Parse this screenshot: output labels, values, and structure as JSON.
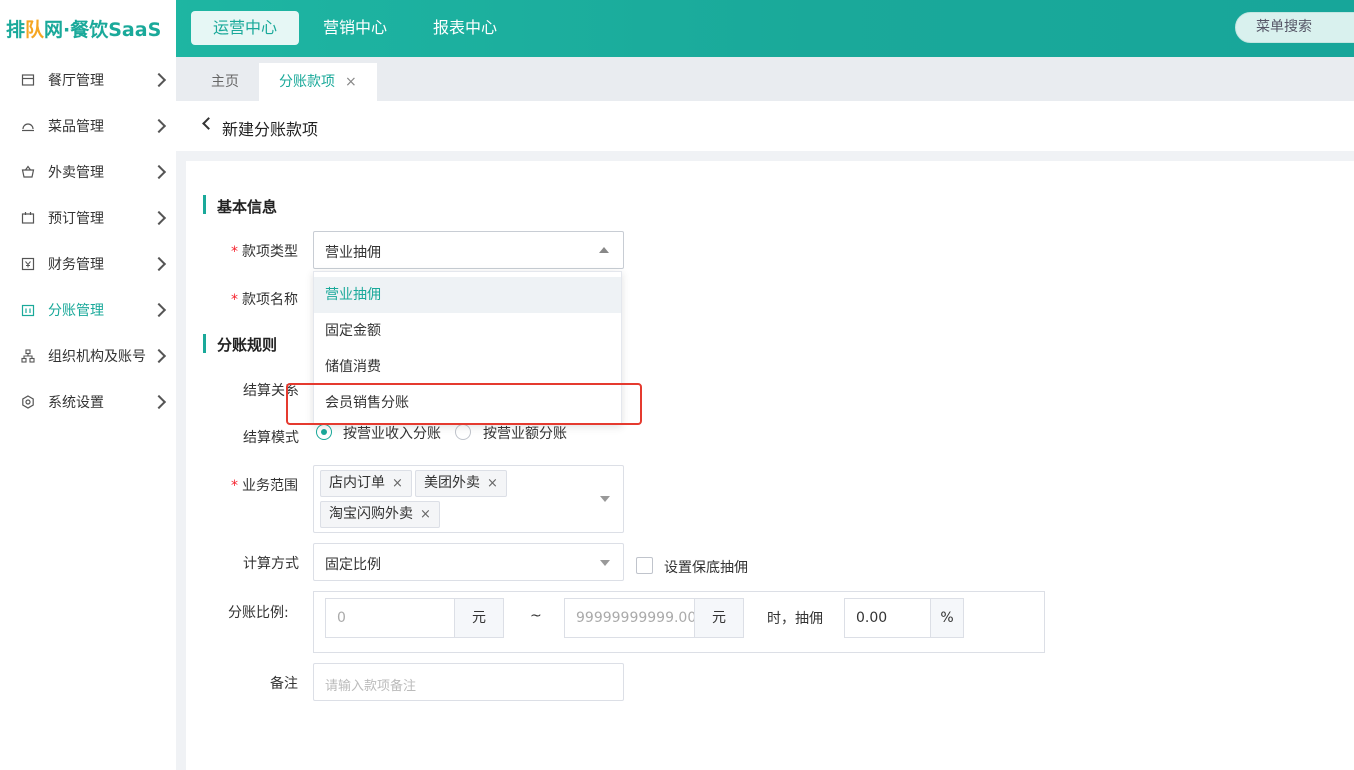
{
  "brand": {
    "logo_prefix": "排",
    "logo_mark": "队",
    "logo_suffix": "网·餐饮SaaS"
  },
  "topnav": [
    {
      "label": "运营中心",
      "active": true
    },
    {
      "label": "营销中心",
      "active": false
    },
    {
      "label": "报表中心",
      "active": false
    }
  ],
  "menu_search_label": "菜单搜索",
  "sidebar": {
    "items": [
      {
        "label": "餐厅管理",
        "icon": "store-icon"
      },
      {
        "label": "菜品管理",
        "icon": "dish-icon"
      },
      {
        "label": "外卖管理",
        "icon": "basket-icon"
      },
      {
        "label": "预订管理",
        "icon": "calendar-icon"
      },
      {
        "label": "财务管理",
        "icon": "finance-icon"
      },
      {
        "label": "分账管理",
        "icon": "split-icon",
        "active": true
      },
      {
        "label": "组织机构及账号",
        "icon": "org-icon"
      },
      {
        "label": "系统设置",
        "icon": "settings-icon"
      }
    ]
  },
  "tabs": [
    {
      "label": "主页"
    },
    {
      "label": "分账款项",
      "close": "×"
    }
  ],
  "page": {
    "title": "新建分账款项"
  },
  "form": {
    "basic_section": "基本信息",
    "rules_section": "分账规则",
    "required_mark": "*",
    "type_label": "款项类型",
    "type_value": "营业抽佣",
    "name_label": "款项名称",
    "dropdown_options": [
      "营业抽佣",
      "固定金额",
      "储值消费",
      "会员销售分账"
    ],
    "settle_relation_label": "结算关系",
    "settle_mode_label": "结算模式",
    "settle_mode_options": [
      "按营业收入分账",
      "按营业额分账"
    ],
    "scope_label": "业务范围",
    "scope_tags": [
      "店内订单",
      "美团外卖",
      "淘宝闪购外卖"
    ],
    "tag_close": "×",
    "calc_label": "计算方式",
    "calc_value": "固定比例",
    "min_commission_label": "设置保底抽佣",
    "ratio_label": "分账比例:",
    "ratio_min_placeholder": "0",
    "ratio_unit": "元",
    "ratio_sep": "~",
    "ratio_max_value": "99999999999.00",
    "ratio_when": "时，抽佣",
    "ratio_rate_value": "0.00",
    "ratio_percent": "%",
    "remark_label": "备注",
    "remark_placeholder": "请输入款项备注"
  },
  "colors": {
    "accent": "#1aa99a",
    "highlight": "#e53a2f",
    "required": "#f5222d"
  }
}
